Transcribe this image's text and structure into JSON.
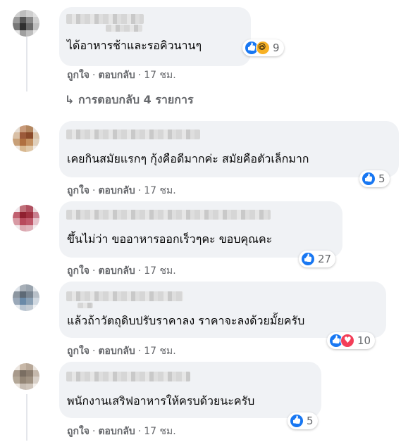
{
  "comments": [
    {
      "text": "ได้อาหารช้าและรอคิวนานๆ",
      "reactions": {
        "icons": [
          "like-icon",
          "haha-icon"
        ],
        "count": "9"
      },
      "actions": {
        "like": "ถูกใจ",
        "reply": "ตอบกลับ",
        "time": "17 ชม."
      },
      "avatar_colors": [
        "#cfcfcf",
        "#bdbdbd",
        "#cfcfcf",
        "#e0e0e0",
        "#9a9a9a",
        "#555555",
        "#8a8a8a",
        "#cfcfcf",
        "#777777",
        "#2f2f2f",
        "#6a6a6a",
        "#bfbfbf",
        "#e0e0e0",
        "#a0a0a0",
        "#bdbdbd",
        "#e8e8e8"
      ]
    },
    {
      "text": "เคยกินสมัยแรกๆ กุ้งคือดีมากค่ะ สมัยคือตัวเล็กมาก",
      "reactions": {
        "icons": [
          "like-icon"
        ],
        "count": "5"
      },
      "actions": {
        "like": "ถูกใจ",
        "reply": "ตอบกลับ",
        "time": "17 ชม."
      },
      "avatar_colors": [
        "#e6ddd3",
        "#c89a7a",
        "#b3865f",
        "#e8e0d8",
        "#d9c0a6",
        "#9c5a3a",
        "#8a4a2a",
        "#d8c2a8",
        "#c8a078",
        "#b07040",
        "#c49060",
        "#e0d0bc",
        "#f0e8e0",
        "#d8b890",
        "#e0c8a8",
        "#f2ece6"
      ]
    },
    {
      "text": "ขึ้นไม่ว่า ขออาหารออกเร็วๆคะ ขอบคุณคะ",
      "reactions": {
        "icons": [
          "like-icon"
        ],
        "count": "27"
      },
      "actions": {
        "like": "ถูกใจ",
        "reply": "ตอบกลับ",
        "time": "17 ชม."
      },
      "avatar_colors": [
        "#f0e6ea",
        "#c0707a",
        "#b05060",
        "#ead8dc",
        "#c06070",
        "#902030",
        "#a03040",
        "#c88090",
        "#d89aa4",
        "#b84a5c",
        "#c0586a",
        "#e6c4cc",
        "#f2eaec",
        "#dcaab2",
        "#e0b4bc",
        "#f4eef0"
      ]
    },
    {
      "text": "แล้วถ้าวัตถุดิบปรับราคาลง ราคาจะลงด้วยมั้ยครับ",
      "reactions": {
        "icons": [
          "like-icon",
          "love-icon"
        ],
        "count": "10"
      },
      "actions": {
        "like": "ถูกใจ",
        "reply": "ตอบกลับ",
        "time": "17 ชม."
      },
      "avatar_colors": [
        "#dfe4ea",
        "#a8b0b8",
        "#9aa4ae",
        "#e4e8ec",
        "#8c96a0",
        "#5e6a76",
        "#7a8692",
        "#b8c0c8",
        "#9aa8b8",
        "#6a8aa8",
        "#8aa0b4",
        "#d0d8e0",
        "#e8ecf0",
        "#b8c4d0",
        "#c4ccd4",
        "#f0f2f4"
      ]
    },
    {
      "text": "พนักงานเสริฟอาหารให้ครบด้วยนะครับ",
      "reactions": {
        "icons": [
          "like-icon"
        ],
        "count": "5"
      },
      "actions": {
        "like": "ถูกใจ",
        "reply": "ตอบกลับ",
        "time": "17 ชม."
      },
      "avatar_colors": [
        "#ece6e0",
        "#c8b8a8",
        "#b8a898",
        "#e8e2dc",
        "#a89a8c",
        "#7a6e62",
        "#8c7e70",
        "#c4b8ac",
        "#b4a898",
        "#948676",
        "#a09282",
        "#d8d0c8",
        "#eee8e2",
        "#c8beb4",
        "#d0c6bc",
        "#f4f0ec"
      ]
    }
  ],
  "replies_link": "↳ การตอบกลับ 4 รายการ",
  "colors": {
    "bubble": "#f0f2f5",
    "secondary_text": "#65676b",
    "like_blue": "#1877f2",
    "haha_yellow": "#f7b125",
    "love_red": "#f33e58"
  }
}
